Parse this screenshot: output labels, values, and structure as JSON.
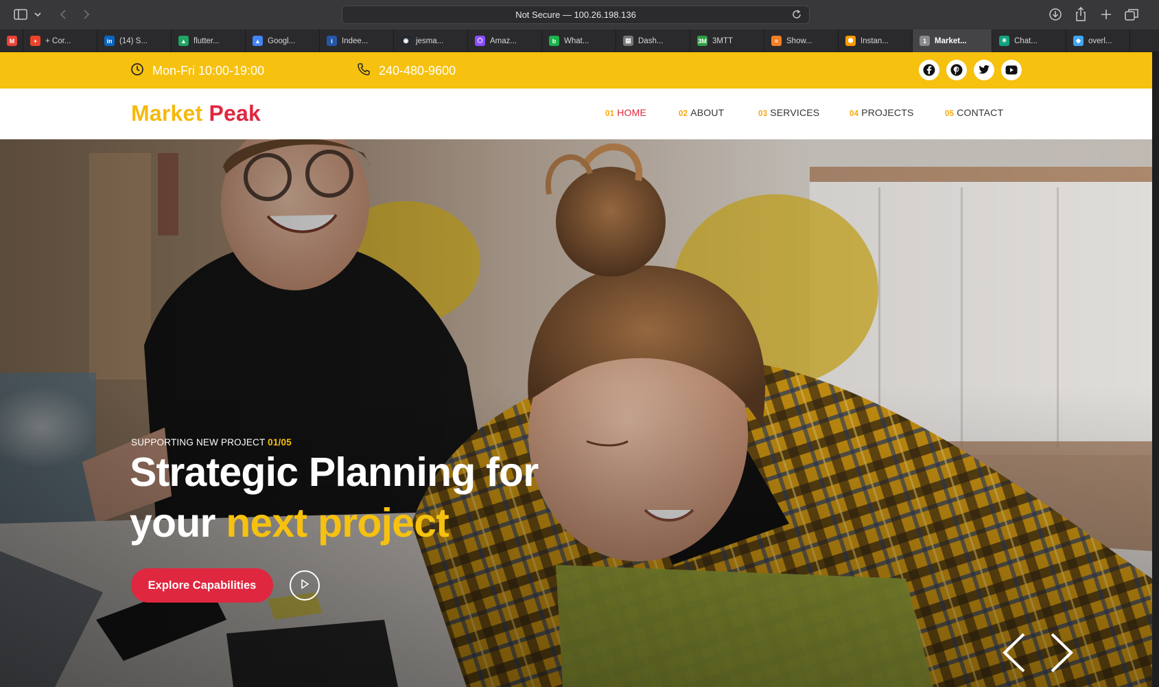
{
  "browser": {
    "address": "Not Secure — 100.26.198.136",
    "toolbar_icons": [
      "sidebar-icon",
      "chevron-down-icon",
      "back-icon",
      "forward-icon",
      "reload-icon",
      "download-icon",
      "share-icon",
      "plus-icon",
      "tab-overview-icon"
    ],
    "tabs": [
      {
        "label": "",
        "favicon": "M",
        "color": "#ea4335"
      },
      {
        "label": "+ Cor...",
        "favicon": "+",
        "color": "#e8452c"
      },
      {
        "label": "(14) S...",
        "favicon": "in",
        "color": "#0a66c2"
      },
      {
        "label": "flutter...",
        "favicon": "▲",
        "color": "#1fa463"
      },
      {
        "label": "Googl...",
        "favicon": "▲",
        "color": "#4285f4"
      },
      {
        "label": "Indee...",
        "favicon": "i",
        "color": "#2557a7"
      },
      {
        "label": "jesma...",
        "favicon": "◉",
        "color": "#24292f"
      },
      {
        "label": "Amaz...",
        "favicon": "⬡",
        "color": "#8c4fff"
      },
      {
        "label": "What...",
        "favicon": "b",
        "color": "#19b24b"
      },
      {
        "label": "Dash...",
        "favicon": "▤",
        "color": "#777777"
      },
      {
        "label": "3MTT",
        "favicon": "3M",
        "color": "#2f9e44"
      },
      {
        "label": "Show...",
        "favicon": "≡",
        "color": "#f48024"
      },
      {
        "label": "Instan...",
        "favicon": "⬢",
        "color": "#ff9900"
      },
      {
        "label": "Market...",
        "favicon": "1",
        "color": "#8a8a8e",
        "active": true
      },
      {
        "label": "Chat...",
        "favicon": "✳",
        "color": "#10a37f"
      },
      {
        "label": "overl...",
        "favicon": "◆",
        "color": "#42a5f5"
      }
    ]
  },
  "topbar": {
    "hours": "Mon-Fri 10:00-19:00",
    "phone": "240-480-9600",
    "hours_icon": "clock-icon",
    "phone_icon": "phone-icon",
    "socials": [
      "facebook-icon",
      "pinterest-icon",
      "twitter-icon",
      "youtube-icon"
    ],
    "color": "#f6c10f"
  },
  "navbar": {
    "logo_word1": "Market",
    "logo_word2": "Peak",
    "items": [
      {
        "num": "01",
        "label": "HOME",
        "active": true
      },
      {
        "num": "02",
        "label": "ABOUT"
      },
      {
        "num": "03",
        "label": "SERVICES"
      },
      {
        "num": "04",
        "label": "PROJECTS"
      },
      {
        "num": "05",
        "label": "CONTACT"
      }
    ]
  },
  "hero": {
    "kicker": "SUPPORTING NEW PROJECT",
    "counter": "01/05",
    "headline_line1": "Strategic Planning for",
    "headline_line2_plain": "your",
    "headline_line2_highlight": "next project",
    "cta_label": "Explore Capabilities",
    "play_icon": "play-icon",
    "prev_icon": "chevron-left-icon",
    "next_icon": "chevron-right-icon",
    "accent": "#f6c10f",
    "cta_color": "#e02740"
  }
}
